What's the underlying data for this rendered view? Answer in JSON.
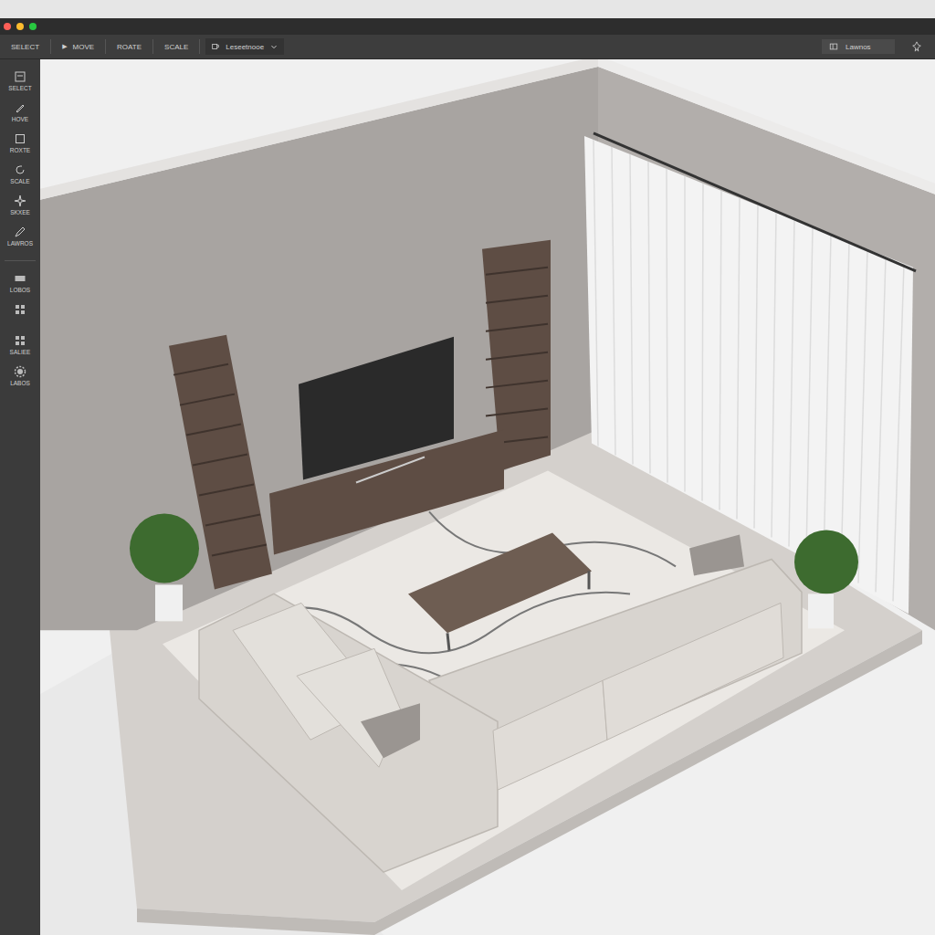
{
  "toolbar": {
    "tools": [
      {
        "label": "SELECT"
      },
      {
        "glyph": "▶",
        "label": "MOVE"
      },
      {
        "label": "ROATE"
      },
      {
        "label": "SCALE"
      }
    ],
    "dropdown": {
      "label": "Leseetnooe"
    },
    "panel_button": {
      "label": "Lawnos"
    }
  },
  "sidebar": {
    "tools": [
      {
        "label": "SELECT"
      },
      {
        "label": "HOVE"
      },
      {
        "label": "ROXTE"
      },
      {
        "label": "SCALE"
      },
      {
        "label": "SKXEE"
      },
      {
        "label": "LAWROS"
      }
    ],
    "assets": [
      {
        "label": "LOBOS"
      },
      {},
      {
        "label": "SALIEE"
      },
      {
        "label": "LABOS"
      }
    ]
  }
}
